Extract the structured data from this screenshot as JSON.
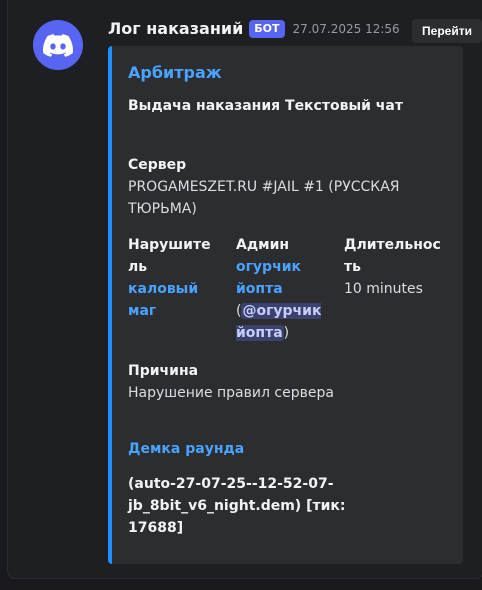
{
  "message": {
    "author": "Лог наказаний",
    "bot_tag": "БОТ",
    "timestamp": "27.07.2025 12:56",
    "goto_button": "Перейти"
  },
  "embed": {
    "author": "Арбитраж",
    "title": "Выдача наказания Текстовый чат",
    "accent_color": "#1e90ff",
    "server": {
      "name": "Сервер",
      "value": "PROGAMESZET.RU #JAIL #1 (РУССКАЯ ТЮРЬМА)"
    },
    "violator": {
      "name": "Нарушитель",
      "value": "каловый маг"
    },
    "admin": {
      "name": "Админ",
      "value": "огурчик йопта",
      "open_paren": "(",
      "mention": "@огурчик йопта",
      "close_paren": ")"
    },
    "duration": {
      "name": "Длительность",
      "value": "10 minutes"
    },
    "reason": {
      "name": "Причина",
      "value": "Нарушение правил сервера"
    },
    "demo": {
      "title": "Демка раунда",
      "value": "(auto-27-07-25--12-52-07-jb_8bit_v6_night.dem) [тик: 17688]"
    }
  }
}
